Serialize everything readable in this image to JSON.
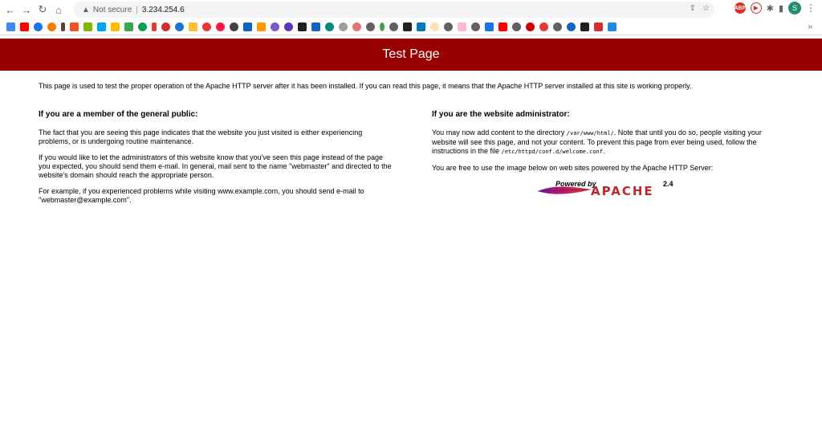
{
  "browser": {
    "security_label": "Not secure",
    "url": "3.234.254.6",
    "profile_initial": "S"
  },
  "page": {
    "title": "Test Page",
    "intro": "This page is used to test the proper operation of the Apache HTTP server after it has been installed. If you can read this page, it means that the Apache HTTP server installed at this site is working properly.",
    "public": {
      "heading": "If you are a member of the general public:",
      "p1": "The fact that you are seeing this page indicates that the website you just visited is either experiencing problems, or is undergoing routine maintenance.",
      "p2": "If you would like to let the administrators of this website know that you've seen this page instead of the page you expected, you should send them e-mail. In general, mail sent to the name \"webmaster\" and directed to the website's domain should reach the appropriate person.",
      "p3": "For example, if you experienced problems while visiting www.example.com, you should send e-mail to \"webmaster@example.com\"."
    },
    "admin": {
      "heading": "If you are the website administrator:",
      "p1_a": "You may now add content to the directory ",
      "p1_code1": "/var/www/html/",
      "p1_b": ". Note that until you do so, people visiting your website will see this page, and not your content. To prevent this page from ever being used, follow the instructions in the file ",
      "p1_code2": "/etc/httpd/conf.d/welcome.conf",
      "p1_c": ".",
      "p2": "You are free to use the image below on web sites powered by the Apache HTTP Server:",
      "logo_powered": "Powered by",
      "logo_word": "APACHE",
      "logo_version": "2.4"
    }
  }
}
